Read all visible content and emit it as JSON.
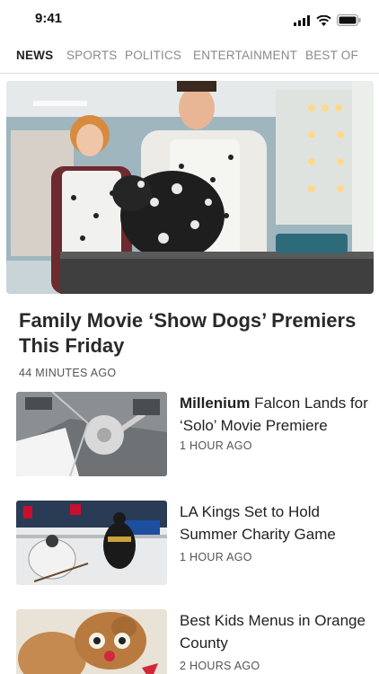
{
  "status_bar": {
    "time": "9:41"
  },
  "tabs": [
    "NEWS",
    "SPORTS",
    "POLITICS",
    "ENTERTAINMENT",
    "BEST OF"
  ],
  "hero": {
    "title": "Family Movie ‘Show Dogs’ Premiers This Friday",
    "time": "44 MINUTES AGO"
  },
  "articles": [
    {
      "title_bold": "Millenium",
      "title_rest": " Falcon Lands for ‘Solo’ Movie Premiere",
      "time": "1 HOUR AGO"
    },
    {
      "title_bold": "",
      "title_rest": "LA Kings Set to Hold Summer Charity Game",
      "time": "1 HOUR AGO"
    },
    {
      "title_bold": "",
      "title_rest": "Best Kids Menus in Orange County",
      "time": "2 HOURS AGO"
    }
  ],
  "colors": {
    "accent_text": "#222222",
    "muted_text": "#8a8a8a"
  },
  "icons": [
    "cellular-signal-icon",
    "wifi-icon",
    "battery-icon"
  ]
}
